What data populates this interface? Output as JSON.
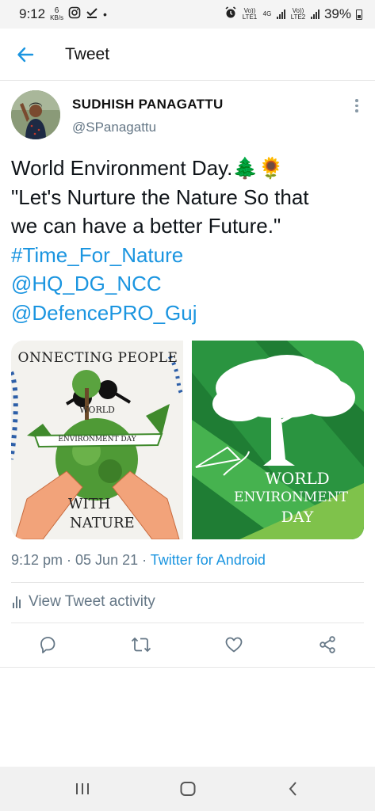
{
  "status_bar": {
    "time": "9:12",
    "net_speed_value": "6",
    "net_speed_unit": "KB/s",
    "lte1_label": "Vo)) LTE1",
    "net_4g_label": "4G",
    "lte2_label": "Vo)) LTE2",
    "battery": "39%"
  },
  "header": {
    "title": "Tweet"
  },
  "tweet": {
    "author_name": "SUDHISH PANAGATTU",
    "author_handle": "@SPanagattu",
    "text_line1": "World Environment Day.🌲🌻",
    "text_line2": "\"Let's Nurture the Nature So that",
    "text_line3": "we can have a better Future.\"",
    "hashtag": "#Time_For_Nature",
    "mention1": "@HQ_DG_NCC",
    "mention2": "@DefencePRO_Guj",
    "timestamp": "9:12 pm · 05 Jun 21 · ",
    "source": "Twitter for Android",
    "activity_label": "View Tweet activity"
  },
  "media": {
    "left": {
      "title": "ONNECTING PEOPLE",
      "ribbon_top": "WORLD",
      "ribbon_bottom": "ENVIRONMENT DAY",
      "caption_top": "WITH",
      "caption_bottom": "NATURE"
    },
    "right": {
      "line1": "WORLD",
      "line2": "ENVIRONMENT",
      "line3": "DAY"
    }
  },
  "icons": {
    "back": "arrow-left-icon",
    "more": "more-vertical-icon",
    "reply": "reply-icon",
    "retweet": "retweet-icon",
    "like": "heart-icon",
    "share": "share-icon"
  },
  "colors": {
    "link": "#1b95e0",
    "secondary_text": "#657786",
    "green_dark": "#1e7d33",
    "green_light": "#7fc24b"
  }
}
